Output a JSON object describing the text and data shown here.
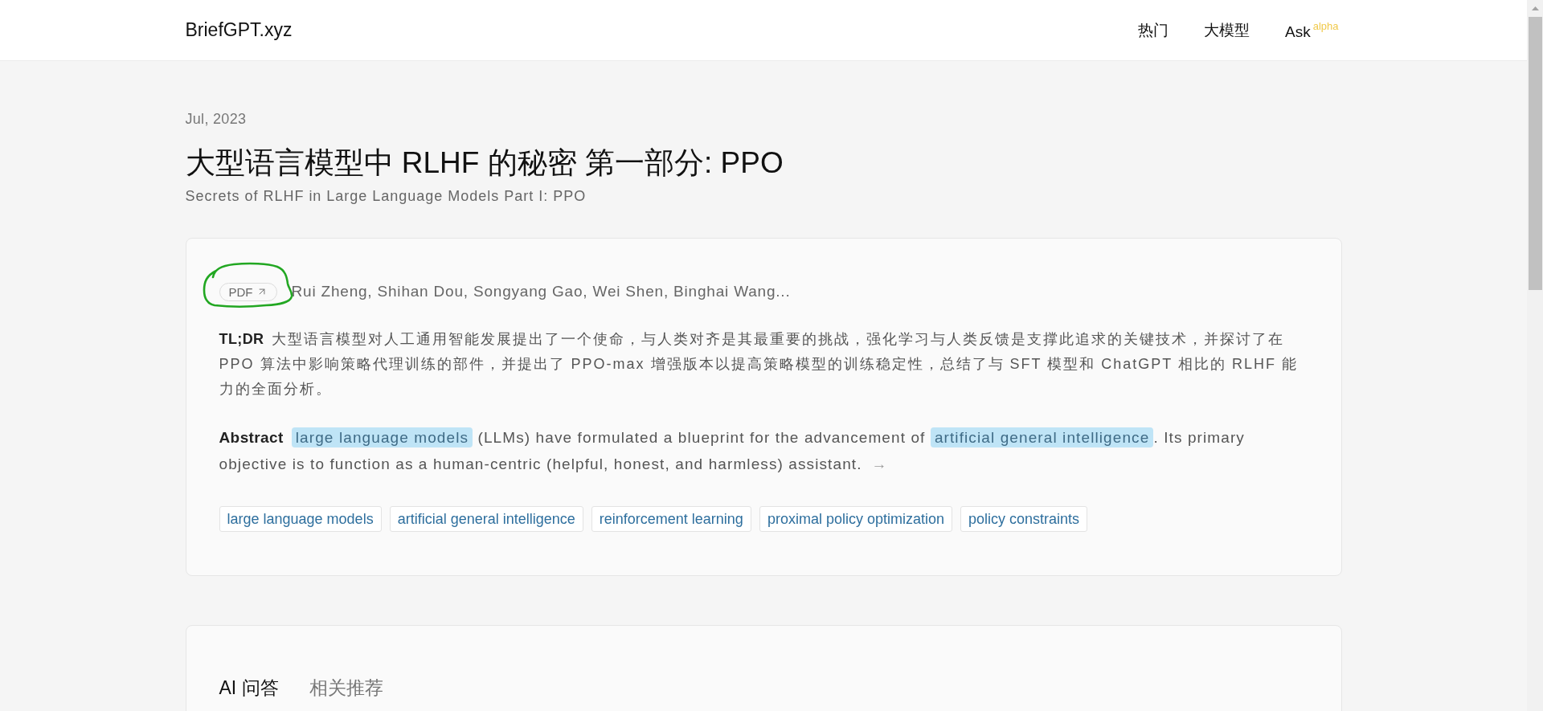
{
  "header": {
    "logo": "BriefGPT.xyz",
    "nav": [
      {
        "label": "热门"
      },
      {
        "label": "大模型"
      },
      {
        "label": "Ask",
        "badge": "alpha"
      }
    ]
  },
  "article": {
    "date": "Jul, 2023",
    "title": "大型语言模型中 RLHF 的秘密 第一部分: PPO",
    "subtitle": "Secrets of RLHF in Large Language Models Part I: PPO"
  },
  "summary_card": {
    "pdf": {
      "label": "PDF",
      "circled": true
    },
    "authors": "Rui Zheng, Shihan Dou, Songyang Gao, Wei Shen, Binghai Wang...",
    "tldr": {
      "label": "TL;DR",
      "text": "大型语言模型对人工通用智能发展提出了一个使命，与人类对齐是其最重要的挑战，强化学习与人类反馈是支撑此追求的关键技术，并探讨了在 PPO 算法中影响策略代理训练的部件，并提出了 PPO-max 增强版本以提高策略模型的训练稳定性，总结了与 SFT 模型和 ChatGPT 相比的 RLHF 能力的全面分析。"
    },
    "abstract": {
      "label": "Abstract",
      "segments": [
        {
          "kind": "highlight",
          "text": "large language models"
        },
        {
          "kind": "text",
          "text": " (LLMs) have formulated a blueprint for the advancement of "
        },
        {
          "kind": "highlight",
          "text": "artificial general intelligence"
        },
        {
          "kind": "text",
          "text": ". Its primary objective is to function as a human-centric (helpful, honest, and harmless) assistant."
        }
      ],
      "more": "→"
    },
    "tags": [
      {
        "label": "large language models"
      },
      {
        "label": "artificial general intelligence"
      },
      {
        "label": "reinforcement learning"
      },
      {
        "label": "proximal policy optimization"
      },
      {
        "label": "policy constraints"
      }
    ]
  },
  "qa_card": {
    "tabs": [
      {
        "label": "AI 问答",
        "selected": true
      },
      {
        "label": "相关推荐",
        "selected": false
      }
    ]
  }
}
